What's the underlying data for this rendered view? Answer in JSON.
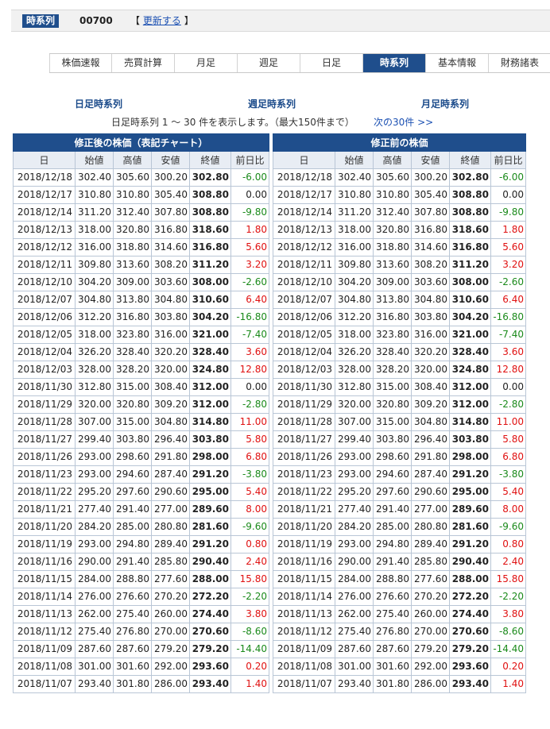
{
  "header": {
    "tag": "時系列",
    "code": "00700",
    "bracket_open": "【",
    "refresh": "更新する",
    "bracket_close": "】"
  },
  "tabs": [
    "株価速報",
    "売買計算",
    "月足",
    "週足",
    "日足",
    "時系列",
    "基本情報",
    "財務諸表"
  ],
  "active_tab": 5,
  "sublinks": {
    "daily": "日足時系列",
    "weekly": "週足時系列",
    "monthly": "月足時系列"
  },
  "info": "日足時系列 1 〜 30 件を表示します。（最大150件まで）",
  "next": "次の30件 >>",
  "colors": {
    "brand": "#1f4e8c",
    "up": "#e01010",
    "down": "#1a8a1a"
  },
  "tables": {
    "left_title": "修正後の株価（表記チャート）",
    "right_title": "修正前の株価",
    "columns": [
      "日",
      "始値",
      "高値",
      "安値",
      "終値",
      "前日比"
    ]
  },
  "rows": [
    [
      "2018/12/18",
      "302.40",
      "305.60",
      "300.20",
      "302.80",
      "-6.00"
    ],
    [
      "2018/12/17",
      "310.80",
      "310.80",
      "305.40",
      "308.80",
      "0.00"
    ],
    [
      "2018/12/14",
      "311.20",
      "312.40",
      "307.80",
      "308.80",
      "-9.80"
    ],
    [
      "2018/12/13",
      "318.00",
      "320.80",
      "316.80",
      "318.60",
      "1.80"
    ],
    [
      "2018/12/12",
      "316.00",
      "318.80",
      "314.60",
      "316.80",
      "5.60"
    ],
    [
      "2018/12/11",
      "309.80",
      "313.60",
      "308.20",
      "311.20",
      "3.20"
    ],
    [
      "2018/12/10",
      "304.20",
      "309.00",
      "303.60",
      "308.00",
      "-2.60"
    ],
    [
      "2018/12/07",
      "304.80",
      "313.80",
      "304.80",
      "310.60",
      "6.40"
    ],
    [
      "2018/12/06",
      "312.20",
      "316.80",
      "303.80",
      "304.20",
      "-16.80"
    ],
    [
      "2018/12/05",
      "318.00",
      "323.80",
      "316.00",
      "321.00",
      "-7.40"
    ],
    [
      "2018/12/04",
      "326.20",
      "328.40",
      "320.20",
      "328.40",
      "3.60"
    ],
    [
      "2018/12/03",
      "328.00",
      "328.20",
      "320.00",
      "324.80",
      "12.80"
    ],
    [
      "2018/11/30",
      "312.80",
      "315.00",
      "308.40",
      "312.00",
      "0.00"
    ],
    [
      "2018/11/29",
      "320.00",
      "320.80",
      "309.20",
      "312.00",
      "-2.80"
    ],
    [
      "2018/11/28",
      "307.00",
      "315.00",
      "304.80",
      "314.80",
      "11.00"
    ],
    [
      "2018/11/27",
      "299.40",
      "303.80",
      "296.40",
      "303.80",
      "5.80"
    ],
    [
      "2018/11/26",
      "293.00",
      "298.60",
      "291.80",
      "298.00",
      "6.80"
    ],
    [
      "2018/11/23",
      "293.00",
      "294.60",
      "287.40",
      "291.20",
      "-3.80"
    ],
    [
      "2018/11/22",
      "295.20",
      "297.60",
      "290.60",
      "295.00",
      "5.40"
    ],
    [
      "2018/11/21",
      "277.40",
      "291.40",
      "277.00",
      "289.60",
      "8.00"
    ],
    [
      "2018/11/20",
      "284.20",
      "285.00",
      "280.80",
      "281.60",
      "-9.60"
    ],
    [
      "2018/11/19",
      "293.00",
      "294.80",
      "289.40",
      "291.20",
      "0.80"
    ],
    [
      "2018/11/16",
      "290.00",
      "291.40",
      "285.80",
      "290.40",
      "2.40"
    ],
    [
      "2018/11/15",
      "284.00",
      "288.80",
      "277.60",
      "288.00",
      "15.80"
    ],
    [
      "2018/11/14",
      "276.00",
      "276.60",
      "270.20",
      "272.20",
      "-2.20"
    ],
    [
      "2018/11/13",
      "262.00",
      "275.40",
      "260.00",
      "274.40",
      "3.80"
    ],
    [
      "2018/11/12",
      "275.40",
      "276.80",
      "270.00",
      "270.60",
      "-8.60"
    ],
    [
      "2018/11/09",
      "287.60",
      "287.60",
      "279.20",
      "279.20",
      "-14.40"
    ],
    [
      "2018/11/08",
      "301.00",
      "301.60",
      "292.00",
      "293.60",
      "0.20"
    ],
    [
      "2018/11/07",
      "293.40",
      "301.80",
      "286.00",
      "293.40",
      "1.40"
    ]
  ]
}
